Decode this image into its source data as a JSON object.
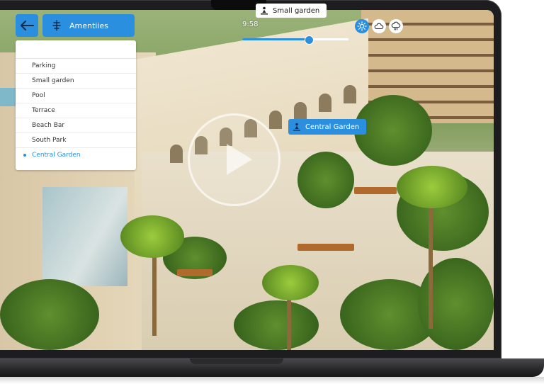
{
  "toolbar": {
    "amenities_label": "Amentiies"
  },
  "amenities_menu": {
    "items": [
      {
        "label": "Parking",
        "active": false
      },
      {
        "label": "Small garden",
        "active": false
      },
      {
        "label": "Pool",
        "active": false
      },
      {
        "label": "Terrace",
        "active": false
      },
      {
        "label": "Beach Bar",
        "active": false
      },
      {
        "label": "South Park",
        "active": false
      },
      {
        "label": "Central Garden",
        "active": true
      }
    ]
  },
  "time_slider": {
    "time": "9:58",
    "value_fraction": 0.62
  },
  "weather": {
    "options": [
      {
        "icon": "sun-icon",
        "selected": true
      },
      {
        "icon": "cloud-icon",
        "selected": false
      },
      {
        "icon": "rain-cloud-icon",
        "selected": false
      }
    ]
  },
  "labels": {
    "small_garden": "Small garden",
    "central_garden": "Central Garden"
  },
  "colors": {
    "accent": "#2b8fe0"
  }
}
